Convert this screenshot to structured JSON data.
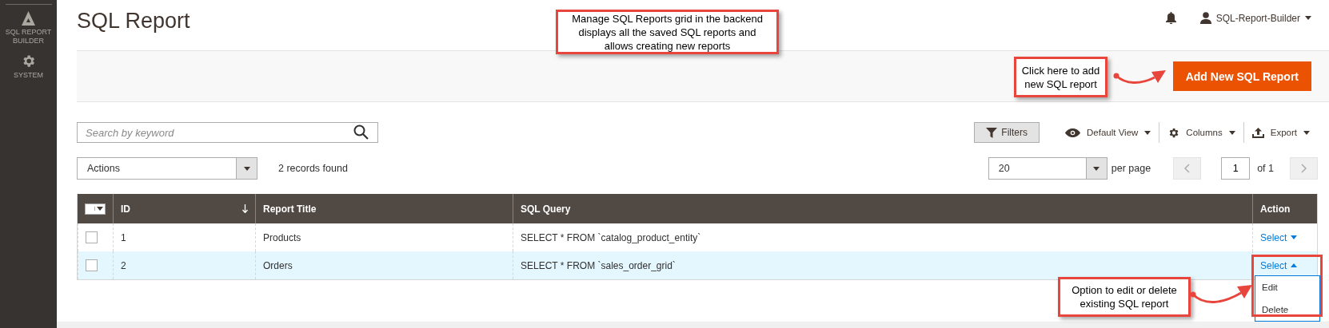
{
  "sidebar": {
    "items": [
      {
        "kind": "logo",
        "label": "SQL REPORT BUILDER"
      },
      {
        "kind": "gear",
        "label": "SYSTEM"
      }
    ]
  },
  "header": {
    "title": "SQL Report",
    "user": "SQL-Report-Builder"
  },
  "page_actions": {
    "add_button": "Add New SQL Report"
  },
  "search": {
    "placeholder": "Search by keyword"
  },
  "toolbar": {
    "filters": "Filters",
    "view": "Default View",
    "columns": "Columns",
    "export": "Export"
  },
  "mass_actions": {
    "value": "Actions"
  },
  "records_found": "2 records found",
  "pager": {
    "per_page_value": "20",
    "per_page_label": "per page",
    "page": "1",
    "of": "of 1"
  },
  "table": {
    "select_all": {
      "checked": false
    },
    "columns": [
      "ID",
      "Report Title",
      "SQL Query",
      "Action"
    ],
    "rows": [
      {
        "checked": false,
        "id": "1",
        "title": "Products",
        "query": "SELECT * FROM `catalog_product_entity`",
        "action": "Select",
        "expanded": false
      },
      {
        "checked": false,
        "id": "2",
        "title": "Orders",
        "query": "SELECT * FROM `sales_order_grid`",
        "action": "Select",
        "expanded": true,
        "menu": [
          "Edit",
          "Delete"
        ]
      }
    ]
  },
  "annotations": {
    "grid_note": "Manage SQL Reports grid in the backend displays all the saved SQL reports and allows creating new reports",
    "add_note": "Click here to add new SQL report",
    "action_note": "Option to edit or delete existing SQL report"
  }
}
